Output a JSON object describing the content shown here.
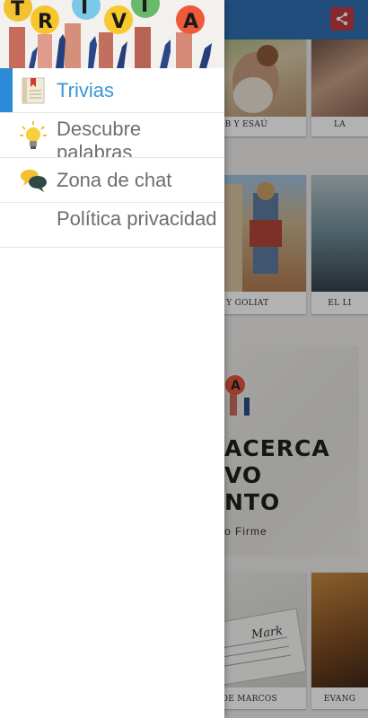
{
  "app": {
    "cards": [
      {
        "caption": "OB Y ESAÚ"
      },
      {
        "caption": "LA"
      },
      {
        "caption": "D Y GOLIAT"
      },
      {
        "caption": "EL LI"
      },
      {
        "caption": "IO DE MARCOS"
      },
      {
        "caption": "EVANG"
      }
    ],
    "banner": {
      "line1": "ACERCA",
      "line2": "VO",
      "line3": "NTO",
      "sub": "o Firme"
    },
    "paper_text": "Mark",
    "share_icon": "share-icon"
  },
  "drawer": {
    "header_letters": [
      "T",
      "R",
      "I",
      "V",
      "I",
      "A"
    ],
    "items": [
      {
        "label": "Trivias",
        "icon": "book-icon"
      },
      {
        "label": "Descubre palabras",
        "icon": "lightbulb-icon"
      },
      {
        "label": "Zona de chat",
        "icon": "chat-bubbles-icon"
      },
      {
        "label": "Política privacidad",
        "icon": ""
      }
    ]
  },
  "colors": {
    "accent": "#2b8bd9",
    "topbar": "#2f6fb0",
    "share": "#c23a44"
  }
}
